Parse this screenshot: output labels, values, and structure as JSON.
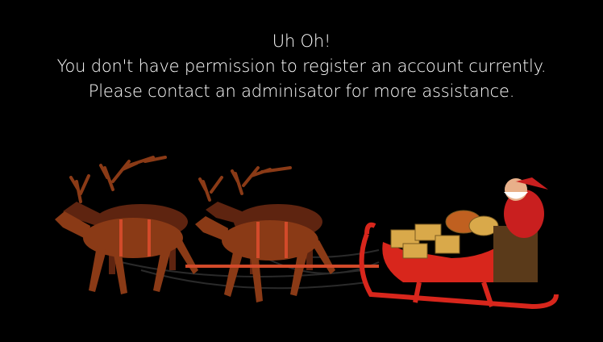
{
  "message": {
    "heading": "Uh Oh!",
    "line1": "You don't have permission to register an account currently.",
    "line2": "Please contact an adminisator for more assistance."
  },
  "illustration": {
    "icon": "santa-sleigh-reindeer-illustration",
    "colors": {
      "background": "#000000",
      "reindeer": "#8a3a16",
      "reindeer_dark": "#5e2410",
      "harness": "#d24a2a",
      "sleigh": "#d8261c",
      "santa_suit": "#c91f1f",
      "gifts": "#d9a94a"
    }
  }
}
